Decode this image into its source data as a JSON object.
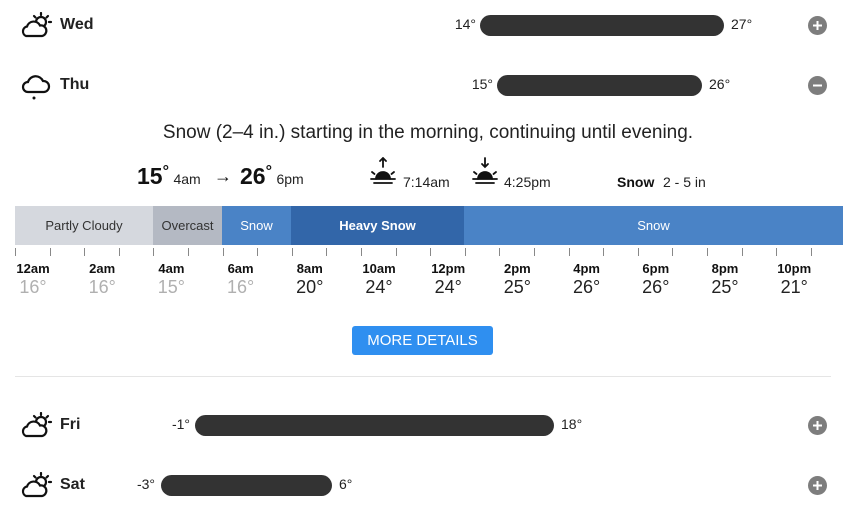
{
  "days": [
    {
      "name": "Wed",
      "icon": "partly-cloudy-icon",
      "lo": "14°",
      "hi": "27°",
      "toggle": "expand"
    },
    {
      "name": "Thu",
      "icon": "snow-cloud-icon",
      "lo": "15°",
      "hi": "26°",
      "toggle": "collapse"
    },
    {
      "name": "Fri",
      "icon": "partly-cloudy-icon",
      "lo": "-1°",
      "hi": "18°",
      "toggle": "expand"
    },
    {
      "name": "Sat",
      "icon": "partly-cloudy-icon",
      "lo": "-3°",
      "hi": "6°",
      "toggle": "expand"
    }
  ],
  "detail": {
    "summary": "Snow (2–4 in.) starting in the morning, continuing until evening.",
    "low_temp": "15",
    "low_time": "4am",
    "arrow": "→",
    "high_temp": "26",
    "high_time": "6pm",
    "degree": "°",
    "sunrise_time": "7:14am",
    "sunset_time": "4:25pm",
    "precip_type": "Snow",
    "precip_amount": "2 - 5 in"
  },
  "conditions": [
    {
      "label": "Partly Cloudy",
      "bg": "#d5d8de",
      "fg": "#333333"
    },
    {
      "label": "Overcast",
      "bg": "#b4b9c3",
      "fg": "#333333"
    },
    {
      "label": "Snow",
      "bg": "#4a83c6",
      "fg": "#ffffff"
    },
    {
      "label": "Heavy Snow",
      "bg": "#3266a9",
      "fg": "#ffffff"
    },
    {
      "label": "Snow",
      "bg": "#4a83c6",
      "fg": "#ffffff"
    }
  ],
  "hours": [
    {
      "label": "12am",
      "temp": "16°",
      "dim": true
    },
    {
      "label": "2am",
      "temp": "16°",
      "dim": true
    },
    {
      "label": "4am",
      "temp": "15°",
      "dim": true
    },
    {
      "label": "6am",
      "temp": "16°",
      "dim": true
    },
    {
      "label": "8am",
      "temp": "20°",
      "dim": false
    },
    {
      "label": "10am",
      "temp": "24°",
      "dim": false
    },
    {
      "label": "12pm",
      "temp": "24°",
      "dim": false
    },
    {
      "label": "2pm",
      "temp": "25°",
      "dim": false
    },
    {
      "label": "4pm",
      "temp": "26°",
      "dim": false
    },
    {
      "label": "6pm",
      "temp": "26°",
      "dim": false
    },
    {
      "label": "8pm",
      "temp": "25°",
      "dim": false
    },
    {
      "label": "10pm",
      "temp": "21°",
      "dim": false
    }
  ],
  "more_details_label": "MORE DETAILS",
  "colors": {
    "bar": "#333333",
    "toggle": "#7d7d7d",
    "button": "#2f8ff0",
    "dim_temp": "#b0b0b0"
  }
}
